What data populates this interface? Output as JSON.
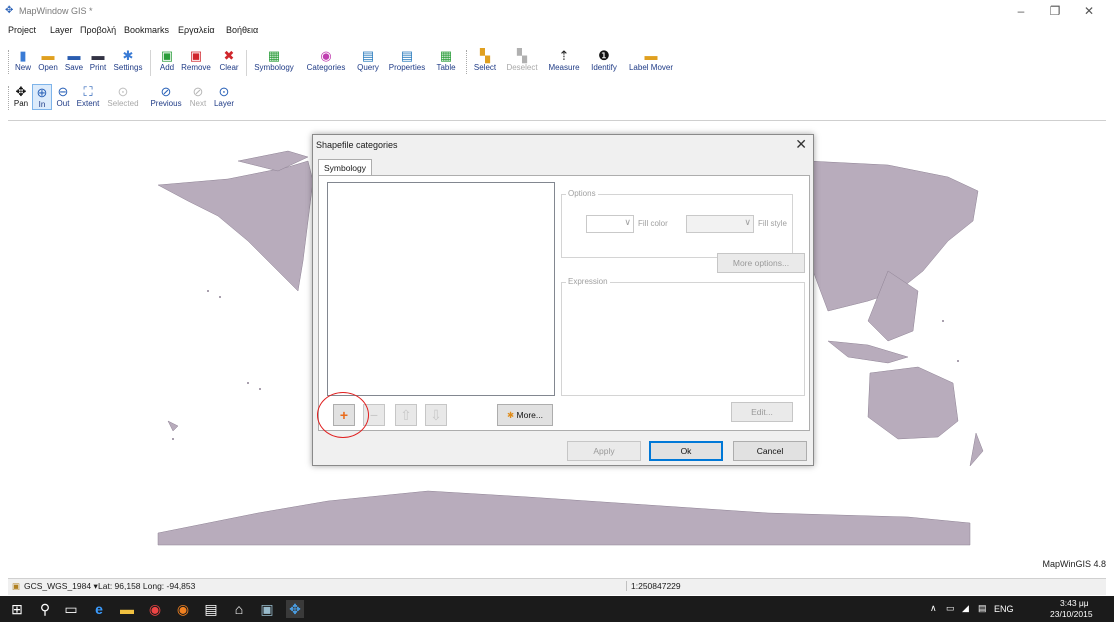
{
  "window": {
    "title": "MapWindow GIS *",
    "icon": "mapwindow-icon",
    "controls": [
      "–",
      "❐",
      "✕"
    ]
  },
  "menu": [
    "Project",
    "Layer",
    "Προβολή",
    "Bookmarks",
    "Εργαλεία",
    "Βοήθεια"
  ],
  "toolbar1": [
    {
      "label": "New",
      "icon": "new-icon",
      "enabled": true
    },
    {
      "label": "Open",
      "icon": "open-icon",
      "enabled": true
    },
    {
      "label": "Save",
      "icon": "save-icon",
      "enabled": true
    },
    {
      "label": "Print",
      "icon": "print-icon",
      "enabled": true
    },
    {
      "label": "Settings",
      "icon": "gear-icon",
      "enabled": true
    },
    {
      "label": "Add",
      "icon": "add-layer-icon",
      "enabled": true
    },
    {
      "label": "Remove",
      "icon": "remove-layer-icon",
      "enabled": true
    },
    {
      "label": "Clear",
      "icon": "clear-icon",
      "enabled": true
    },
    {
      "label": "Symbology",
      "icon": "symbology-icon",
      "enabled": true
    },
    {
      "label": "Categories",
      "icon": "categories-icon",
      "enabled": true
    },
    {
      "label": "Query",
      "icon": "query-icon",
      "enabled": true
    },
    {
      "label": "Properties",
      "icon": "properties-icon",
      "enabled": true
    },
    {
      "label": "Table",
      "icon": "table-icon",
      "enabled": true
    },
    {
      "label": "Select",
      "icon": "select-icon",
      "enabled": true
    },
    {
      "label": "Deselect",
      "icon": "deselect-icon",
      "enabled": false
    },
    {
      "label": "Measure",
      "icon": "measure-icon",
      "enabled": true
    },
    {
      "label": "Identify",
      "icon": "info-icon",
      "enabled": true
    },
    {
      "label": "Label Mover",
      "icon": "label-mover-icon",
      "enabled": true
    }
  ],
  "toolbar2": [
    {
      "label": "Pan",
      "icon": "pan-icon",
      "enabled": true
    },
    {
      "label": "In",
      "icon": "zoom-in-icon",
      "enabled": true
    },
    {
      "label": "Out",
      "icon": "zoom-out-icon",
      "enabled": true
    },
    {
      "label": "Extent",
      "icon": "extent-icon",
      "enabled": true
    },
    {
      "label": "Selected",
      "icon": "zoom-selected-icon",
      "enabled": false
    },
    {
      "label": "Previous",
      "icon": "previous-icon",
      "enabled": true
    },
    {
      "label": "Next",
      "icon": "next-icon",
      "enabled": false
    },
    {
      "label": "Layer",
      "icon": "zoom-layer-icon",
      "enabled": true
    }
  ],
  "map": {
    "land_color": "#b8acbc",
    "version": "MapWinGIS 4.8"
  },
  "dialog": {
    "title": "Shapefile categories",
    "tab": "Symbology",
    "options_label": "Options",
    "fill_color_label": "Fill color",
    "fill_style_label": "Fill style",
    "more_options": "More options...",
    "expression_label": "Expression",
    "edit": "Edit...",
    "more": "More...",
    "apply": "Apply",
    "ok": "Ok",
    "cancel": "Cancel",
    "add_symbol": "+",
    "highlight_color": "#e02020"
  },
  "status": {
    "projection": "GCS_WGS_1984",
    "coords": "Lat: 96,158 Long: -94,853",
    "scale": "1:250847229"
  },
  "taskbar": {
    "lang": "ENG",
    "time": "3:43 μμ",
    "date": "23/10/2015"
  }
}
